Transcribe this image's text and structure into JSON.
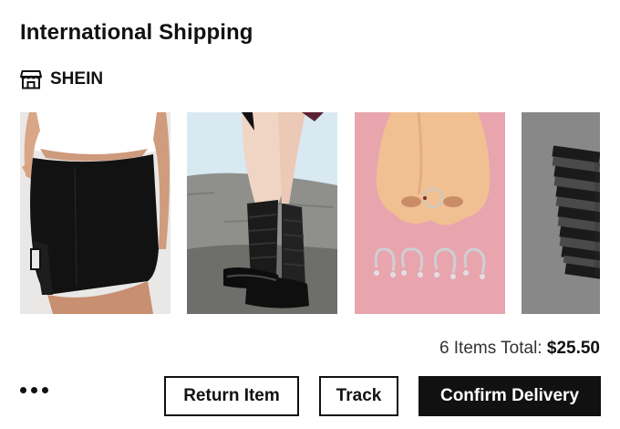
{
  "header": {
    "title": "International Shipping"
  },
  "store": {
    "name": "SHEIN",
    "icon": "storefront-icon"
  },
  "products": [
    {
      "name": "product-image-black-skirt",
      "bg": "#ecebea"
    },
    {
      "name": "product-image-leg-warmers",
      "bg": "#cfe3ee"
    },
    {
      "name": "product-image-nose-rings",
      "bg": "#e6a3ab"
    },
    {
      "name": "product-image-striped-arm-warmers",
      "bg": "#7d7d7d"
    }
  ],
  "summary": {
    "items_label": "6 Items Total:",
    "amount": "$25.50"
  },
  "actions": {
    "more_icon": "more-dots-icon",
    "return_label": "Return Item",
    "track_label": "Track",
    "confirm_label": "Confirm Delivery"
  }
}
